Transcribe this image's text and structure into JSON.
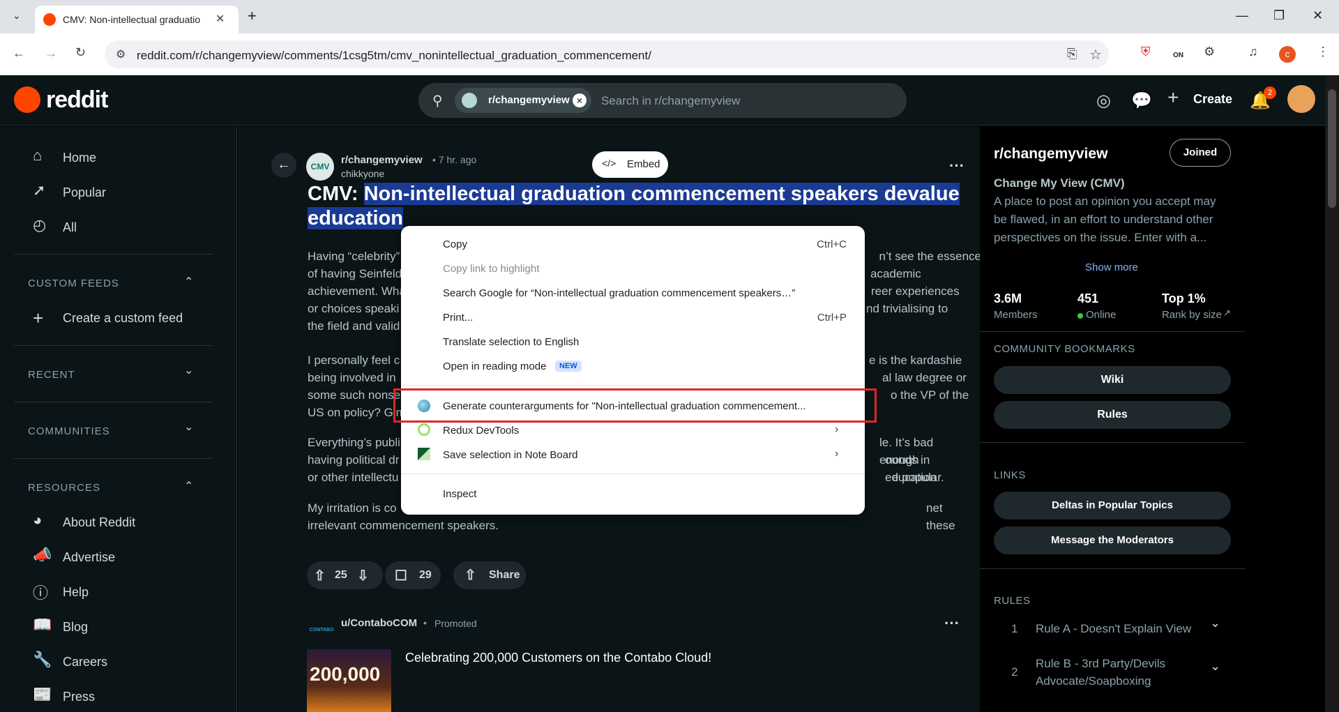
{
  "browser": {
    "tab_title": "CMV: Non-intellectual graduatio",
    "url": "reddit.com/r/changemyview/comments/1csg5tm/cmv_nonintellectual_graduation_commencement/",
    "extension_on": "ON",
    "profile_letter": "c"
  },
  "header": {
    "logo_text": "reddit",
    "search_chip": "r/changemyview",
    "search_placeholder": "Search in r/changemyview",
    "create_label": "Create",
    "notif_count": "2"
  },
  "sidebar": {
    "nav": [
      {
        "label": "Home",
        "icon": "home-icon"
      },
      {
        "label": "Popular",
        "icon": "popular-icon"
      },
      {
        "label": "All",
        "icon": "all-icon"
      }
    ],
    "custom_feeds_title": "CUSTOM FEEDS",
    "create_feed": "Create a custom feed",
    "recent_title": "RECENT",
    "communities_title": "COMMUNITIES",
    "resources_title": "RESOURCES",
    "resources": [
      {
        "label": "About Reddit",
        "icon": "alien-icon"
      },
      {
        "label": "Advertise",
        "icon": "megaphone-icon"
      },
      {
        "label": "Help",
        "icon": "help-icon"
      },
      {
        "label": "Blog",
        "icon": "book-icon"
      },
      {
        "label": "Careers",
        "icon": "wrench-icon"
      },
      {
        "label": "Press",
        "icon": "press-icon"
      }
    ]
  },
  "post": {
    "subreddit": "r/changemyview",
    "age": "• 7 hr. ago",
    "author": "chikkyone",
    "embed_label": "Embed",
    "title_prefix": "CMV: ",
    "title_highlight_1": "Non-intellectual graduation commencement speakers devalue",
    "title_highlight_2": "education",
    "para1_l1a": "Having “celebrity”",
    "para1_l1b": "n’t see the essence",
    "para1_l2a": "of having Seinfeld",
    "para1_l2b": "academic",
    "para1_l3a": "achievement. Wha",
    "para1_l3b": "reer experiences",
    "para1_l4a": "or choices speaki",
    "para1_l4b": "nd trivialising to",
    "para1_l5": "the field and valid",
    "para2_l1a": "I personally feel c",
    "para2_l1b": "e is the kardashie",
    "para2_l2a": "being involved in",
    "para2_l2b": "al law degree or",
    "para2_l3a": "some such nonse",
    "para2_l3b": "o the VP of the",
    "para2_l4": "US on policy? Gim",
    "para3_l1a": "Everything’s publi",
    "para3_l1b": "le. It’s bad enough",
    "para3_l2a": "having political dr",
    "para3_l2b": "ounds in education",
    "para3_l3a": "or other intellectu",
    "para3_l3b": "e popular.",
    "para4_l1a": "My irritation is co",
    "para4_l1b": "net these",
    "para4_l2": "irrelevant commencement speakers.",
    "upvotes": "25",
    "comments": "29",
    "share": "Share"
  },
  "promo": {
    "user": "u/ContaboCOM",
    "tag": "Promoted",
    "headline": "Celebrating 200,000 Customers on the Contabo Cloud!",
    "image_text": "200,000",
    "logo_text": "CONTABO"
  },
  "community": {
    "name": "r/changemyview",
    "joined": "Joined",
    "full_name": "Change My View (CMV)",
    "desc_1": "A place to post an opinion you accept may",
    "desc_2": "be flawed, in an effort to understand other",
    "desc_3": "perspectives on the issue. Enter with a...",
    "show_more": "Show more",
    "members": "3.6M",
    "members_label": "Members",
    "online": "451",
    "online_label": "Online",
    "rank": "Top 1%",
    "rank_label": "Rank by size",
    "bookmarks_title": "COMMUNITY BOOKMARKS",
    "wiki": "Wiki",
    "rules_btn": "Rules",
    "links_title": "LINKS",
    "link1": "Deltas in Popular Topics",
    "link2": "Message the Moderators",
    "rules_title": "RULES",
    "rule1_num": "1",
    "rule1": "Rule A - Doesn't Explain View",
    "rule2_num": "2",
    "rule2_a": "Rule B - 3rd Party/Devils",
    "rule2_b": "Advocate/Soapboxing"
  },
  "context_menu": {
    "copy": "Copy",
    "copy_short": "Ctrl+C",
    "copy_link": "Copy link to highlight",
    "search_google": "Search Google for “Non-intellectual graduation commencement speakers…”",
    "print": "Print...",
    "print_short": "Ctrl+P",
    "translate": "Translate selection to English",
    "reading_mode": "Open in reading mode",
    "new_badge": "NEW",
    "generate": "Generate counterarguments for \"Non-intellectual graduation commencement...",
    "redux": "Redux DevTools",
    "note_board": "Save selection in Note Board",
    "inspect": "Inspect"
  },
  "colors": {
    "reddit_orange": "#ff4500",
    "highlight": "#1a3a93",
    "annotation_red": "#e0262b",
    "bg": "#0b1416"
  }
}
